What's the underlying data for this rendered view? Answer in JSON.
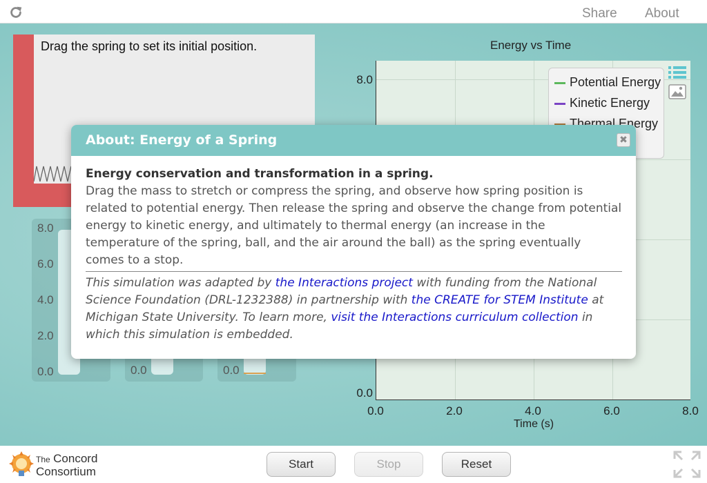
{
  "topbar": {
    "share_label": "Share",
    "about_label": "About"
  },
  "simulation": {
    "instruction": "Drag the spring to set its initial position."
  },
  "bar_charts": {
    "ticks": [
      "8.0",
      "6.0",
      "4.0",
      "2.0",
      "0.0"
    ],
    "zero_label_2": "0.0",
    "zero_label_3": "0.0"
  },
  "graph": {
    "title": "Energy vs Time",
    "legend": [
      "Potential Energy",
      "Kinetic Energy",
      "Thermal Energy"
    ]
  },
  "chart_data": {
    "type": "line",
    "title": "Energy vs Time",
    "xlabel": "Time (s)",
    "ylabel": "",
    "xlim": [
      0,
      8
    ],
    "ylim": [
      0,
      8
    ],
    "x_ticks": [
      "0.0",
      "2.0",
      "4.0",
      "6.0",
      "8.0"
    ],
    "y_ticks": [
      "8.0",
      "0.0"
    ],
    "series": [
      {
        "name": "Potential Energy",
        "color": "#5cb85c",
        "values": []
      },
      {
        "name": "Kinetic Energy",
        "color": "#7b44c4",
        "values": []
      },
      {
        "name": "Thermal Energy",
        "color": "#b07a3c",
        "values": []
      }
    ],
    "grid": true,
    "legend_position": "top-right"
  },
  "modal": {
    "title": "About: Energy of a Spring",
    "subtitle": "Energy conservation and transformation in a spring.",
    "description": "Drag the mass to stretch or compress the spring, and observe how spring position is related to potential energy. Then release the spring and observe the change from potential energy to kinetic energy, and ultimately to thermal energy (an increase in the temperature of the spring, ball, and the air around the ball) as the spring eventually comes to a stop.",
    "credits": {
      "t1": "This simulation was adapted by ",
      "link1": "the Interactions project",
      "t2": " with funding from the National Science Foundation (DRL-1232388) in partnership with ",
      "link2": "the CREATE for STEM Institute",
      "t3": " at Michigan State University. To learn more, ",
      "link3": "visit the Interactions curriculum collection",
      "t4": " in which this simulation is embedded."
    }
  },
  "controls": {
    "start_label": "Start",
    "stop_label": "Stop",
    "reset_label": "Reset"
  },
  "logo": {
    "line1_small": "The",
    "line1": "Concord",
    "line2": "Consortium"
  },
  "colors": {
    "accent": "#7fc7c5",
    "wall": "#d85a5c",
    "link": "#1717c9"
  }
}
